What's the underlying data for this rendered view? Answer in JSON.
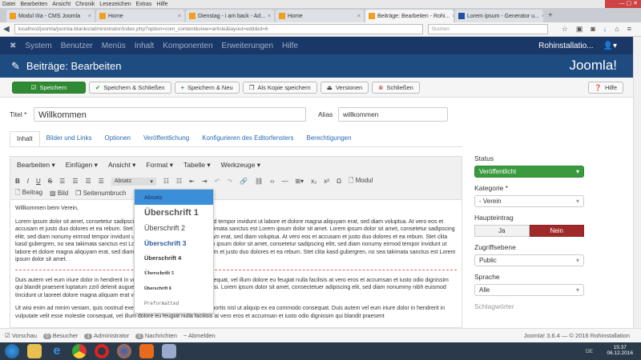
{
  "browser": {
    "menu": [
      "Datei",
      "Bearbeiten",
      "Ansicht",
      "Chronik",
      "Lesezeichen",
      "Extras",
      "Hilfe"
    ],
    "tabs": [
      "Modul IIIa - CMS Joomla",
      "Home",
      "Dienstag - i am back - Ad...",
      "Home",
      "Beiträge: Bearbeiten - Rohi...",
      "Lorem ipsum - Generator u..."
    ],
    "url": "localhost/joomla/joomla-blanko/administrator/index.php?option=com_content&view=article&layout=edit&id=6",
    "search_placeholder": "Suchen"
  },
  "nav": {
    "items": [
      "System",
      "Benutzer",
      "Menüs",
      "Inhalt",
      "Komponenten",
      "Erweiterungen",
      "Hilfe"
    ],
    "site": "Rohinstallatio...",
    "logo": "Joomla!"
  },
  "header": {
    "title": "Beiträge: Bearbeiten"
  },
  "toolbar": {
    "save": "Speichern",
    "save_close": "Speichern & Schließen",
    "save_new": "Speichern & Neu",
    "save_copy": "Als Kopie speichern",
    "versions": "Versionen",
    "close": "Schließen",
    "help": "Hilfe"
  },
  "form": {
    "title_label": "Titel *",
    "title_value": "Willkommen",
    "alias_label": "Alias",
    "alias_value": "willkommen"
  },
  "tabs": [
    "Inhalt",
    "Bilder und Links",
    "Optionen",
    "Veröffentlichung",
    "Konfigurieren des Editorfensters",
    "Berechtigungen"
  ],
  "editor": {
    "menu": [
      "Bearbeiten ▾",
      "Einfügen ▾",
      "Ansicht ▾",
      "Format ▾",
      "Tabelle ▾",
      "Werkzeuge ▾"
    ],
    "format": "Absatz",
    "modul": "Modul",
    "beitrag": "Beitrag",
    "bild": "Bild",
    "seitenumbruch": "Seitenumbruch",
    "paragraphs": [
      "Willkommen beim Verein,",
      "Lorem ipsum dolor sit amet, consetetur sadipscing elitr, sed diam nonumy eirmod tempor invidunt ut labore et dolore magna aliquyam erat, sed diam voluptua. At vero eos et accusam et justo duo dolores et ea rebum. Stet clita kasd gubergren, no sea takimata sanctus est Lorem ipsum dolor sit amet. Lorem ipsum dolor sit amet, consetetur sadipscing elitr, sed diam nonumy eirmod tempor invidunt ut labore et dolore magna aliquyam erat, sed diam voluptua. At vero eos et accusam et justo duo dolores et ea rebum. Stet clita kasd gubergren, no sea takimata sanctus est Lorem ipsum dolor sit amet. Lorem ipsum dolor sit amet, consetetur sadipscing elitr, sed diam nonumy eirmod tempor invidunt ut labore et dolore magna aliquyam erat, sed diam voluptua. At vero eos et accusam et justo duo dolores et ea rebum. Stet clita kasd gubergren, no sea takimata sanctus est Lorem ipsum dolor sit amet.",
      "Duis autem vel eum iriure dolor in hendrerit in vulputate velit esse molestie consequat, vel illum dolore eu feugiat nulla facilisis at vero eros et accumsan et iusto odio dignissim qui blandit praesent luptatum zzril delenit augue duis dolore te feugait nulla facilisi. Lorem ipsum dolor sit amet, consectetuer adipiscing elit, sed diam nonummy nibh euismod tincidunt ut laoreet dolore magna aliquam erat volutpat.",
      "Ut wisi enim ad minim veniam, quis nostrud exerci tation ullamcorper suscipit lobortis nisl ut aliquip ex ea commodo consequat. Duis autem vel eum iriure dolor in hendrerit in vulputate velit esse molestie consequat, vel illum dolore eu feugiat nulla facilisis at vero eros et accumsan et iusto odio dignissim qui blandit praesent"
    ],
    "dropdown": [
      "Absatz",
      "Überschrift 1",
      "Überschrift 2",
      "Überschrift 3",
      "Überschrift 4",
      "Überschrift 5",
      "Überschrift 6",
      "Preformatted"
    ]
  },
  "sidebar": {
    "status_label": "Status",
    "status": "Veröffentlicht",
    "category_label": "Kategorie *",
    "category": "- Verein",
    "featured_label": "Haupteintrag",
    "yes": "Ja",
    "no": "Nein",
    "access_label": "Zugriffsebene",
    "access": "Public",
    "language_label": "Sprache",
    "language": "Alle",
    "tags_label": "Schlagwörter"
  },
  "statusbar": {
    "preview": "Vorschau",
    "visitors_count": "0",
    "visitors": "Besucher",
    "admin_count": "1",
    "admin": "Administrator",
    "messages_count": "0",
    "messages": "Nachrichten",
    "logout": "Abmelden",
    "version": "Joomla! 3.6.4 — © 2016 Rohinstallation"
  },
  "taskbar": {
    "lang": "DE",
    "time": "15:37",
    "date": "06.12.2016"
  },
  "colors": {
    "nav": "#1a3867",
    "header": "#1e4b80",
    "green": "#2f8a34",
    "red": "#a02a2a",
    "highlight": "#3a8fd8"
  }
}
